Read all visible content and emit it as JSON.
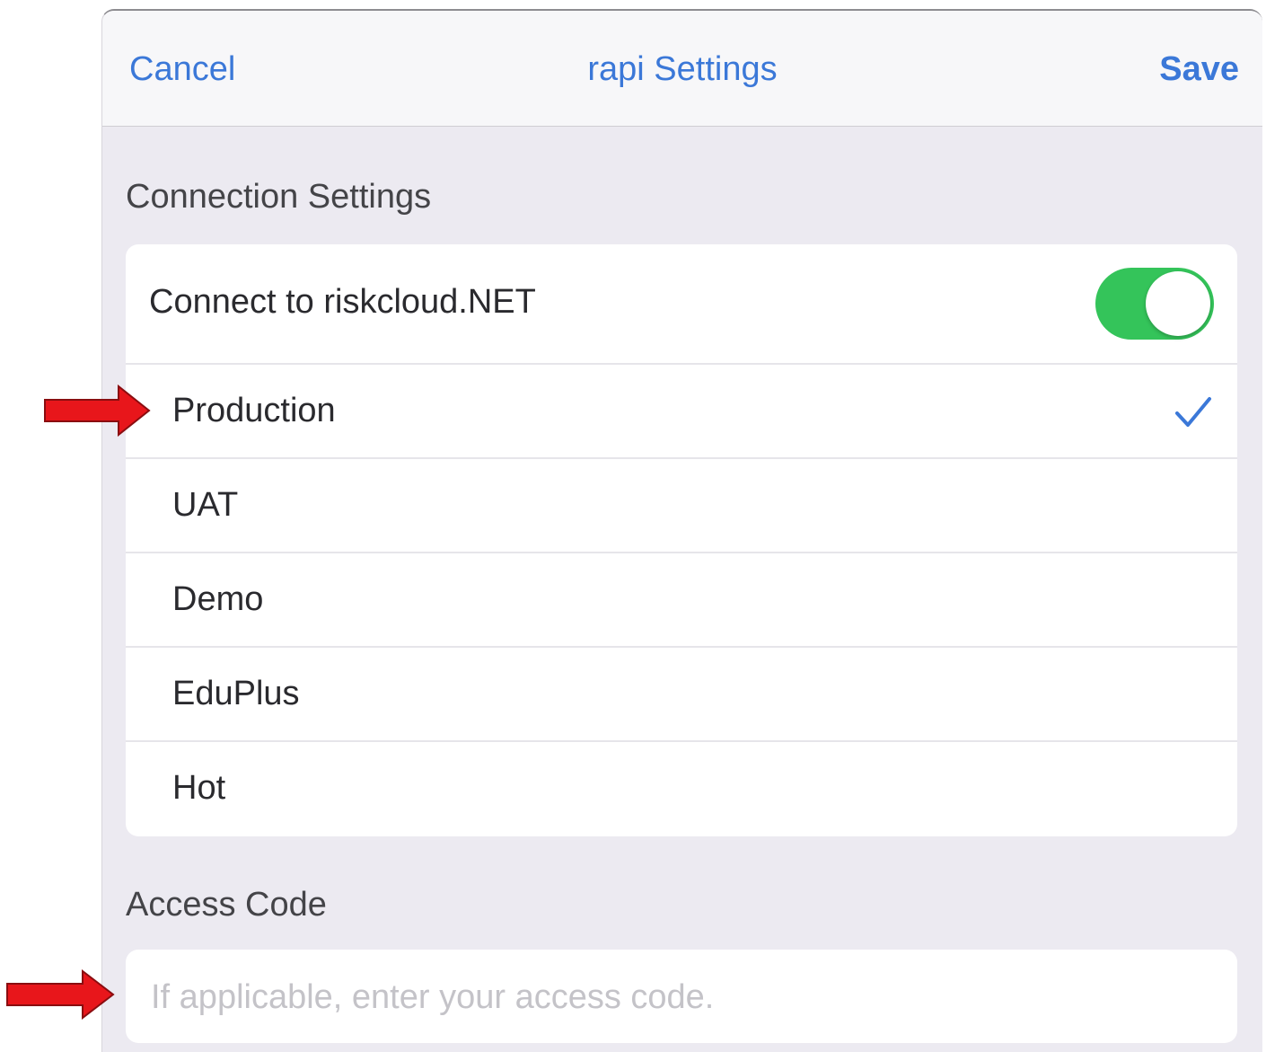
{
  "navbar": {
    "cancel_label": "Cancel",
    "title": "rapi Settings",
    "save_label": "Save"
  },
  "connection_section": {
    "header": "Connection Settings",
    "connect_label": "Connect to riskcloud.NET",
    "connect_enabled": true,
    "environments": [
      {
        "label": "Production",
        "selected": true
      },
      {
        "label": "UAT",
        "selected": false
      },
      {
        "label": "Demo",
        "selected": false
      },
      {
        "label": "EduPlus",
        "selected": false
      },
      {
        "label": "Hot",
        "selected": false
      }
    ]
  },
  "access_section": {
    "header": "Access Code",
    "input_value": "",
    "input_placeholder": "If applicable, enter your access code."
  },
  "colors": {
    "accent": "#3b78d8",
    "toggle_on": "#34c45a",
    "annotation_arrow": "#e8161b",
    "background": "#eceaf1"
  },
  "icons": {
    "selected_indicator": "checkmark-icon",
    "annotation": "red-arrow-icon"
  }
}
